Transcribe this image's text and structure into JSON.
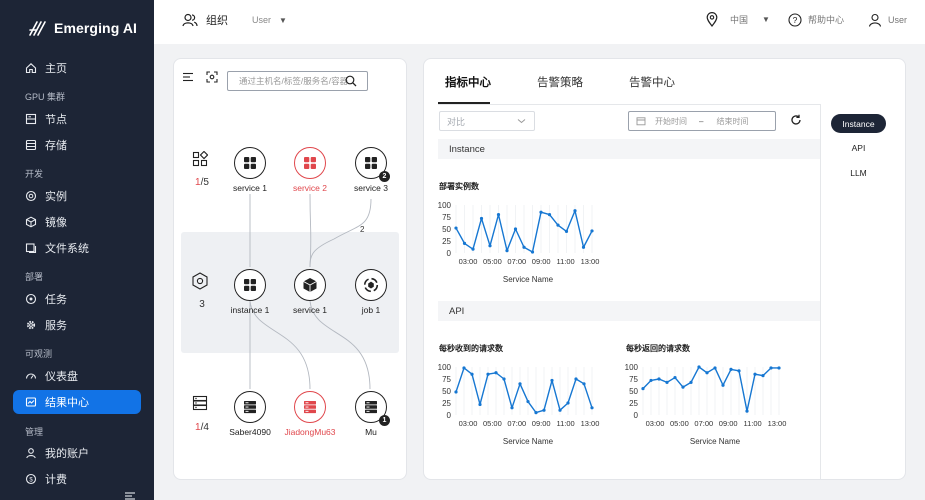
{
  "app": {
    "brand": "Emerging AI"
  },
  "topbar": {
    "org_label": "组织",
    "user_select": "User",
    "region": "中国",
    "help": "帮助中心",
    "user": "User"
  },
  "sidebar": {
    "home": "主页",
    "group_gpu": "GPU 集群",
    "nodes": "节点",
    "storage": "存储",
    "group_dev": "开发",
    "instances": "实例",
    "images": "镜像",
    "filesystem": "文件系统",
    "group_deploy": "部署",
    "tasks": "任务",
    "services": "服务",
    "group_observe": "可观测",
    "dashboard": "仪表盘",
    "results": "结果中心",
    "group_manage": "管理",
    "account": "我的账户",
    "billing": "计费",
    "active_item": "结果中心"
  },
  "topology": {
    "search_placeholder": "通过主机名/标签/服务名/容器",
    "services_row": {
      "count_highlight": "1",
      "count_rest": "/5",
      "nodes": [
        {
          "label": "service 1",
          "icon": "grid-icon",
          "status": "normal",
          "badge": ""
        },
        {
          "label": "service 2",
          "icon": "grid-icon",
          "status": "error",
          "badge": ""
        },
        {
          "label": "service 3",
          "icon": "grid-icon",
          "status": "normal",
          "badge": "2"
        }
      ]
    },
    "instances_row": {
      "count": "3",
      "nodes": [
        {
          "label": "instance 1",
          "icon": "grid-icon",
          "status": "normal",
          "badge": ""
        },
        {
          "label": "service 1",
          "icon": "cube-icon",
          "status": "normal",
          "badge": ""
        },
        {
          "label": "job 1",
          "icon": "job-icon",
          "status": "normal",
          "badge": ""
        }
      ]
    },
    "hosts_row": {
      "count_highlight": "1",
      "count_rest": "/4",
      "nodes": [
        {
          "label": "Saber4090",
          "icon": "server-icon",
          "status": "normal",
          "badge": ""
        },
        {
          "label": "JiadongMu63",
          "icon": "server-icon",
          "status": "error",
          "badge": ""
        },
        {
          "label": "Mu",
          "icon": "server-icon",
          "status": "normal",
          "badge": "1"
        }
      ]
    },
    "edge_label": "2"
  },
  "metrics": {
    "tabs": [
      "指标中心",
      "告警策略",
      "告警中心"
    ],
    "active_tab": "指标中心",
    "compare_placeholder": "对比",
    "start_placeholder": "开始时间",
    "range_sep": "–",
    "end_placeholder": "结束时间",
    "side_items": [
      "Instance",
      "API",
      "LLM"
    ],
    "active_side": "Instance",
    "section_instance": "Instance",
    "section_api": "API"
  },
  "colors": {
    "accent": "#1273e6",
    "sidebar_bg": "#1d2536",
    "error": "#e0474c",
    "line": "#1677d2"
  },
  "chart_data": [
    {
      "type": "line",
      "title": "部署实例数",
      "xlabel": "Service Name",
      "ylabel": "",
      "ylim": [
        0,
        100
      ],
      "yticks": [
        0,
        25,
        50,
        75,
        100
      ],
      "xticks": [
        "03:00",
        "05:00",
        "07:00",
        "09:00",
        "11:00",
        "13:00"
      ],
      "values": [
        52,
        20,
        8,
        72,
        15,
        80,
        5,
        50,
        12,
        2,
        85,
        80,
        58,
        45,
        88,
        12,
        46
      ]
    },
    {
      "type": "line",
      "title": "每秒收到的请求数",
      "xlabel": "Service Name",
      "ylabel": "",
      "ylim": [
        0,
        100
      ],
      "yticks": [
        0,
        25,
        50,
        75,
        100
      ],
      "xticks": [
        "03:00",
        "05:00",
        "07:00",
        "09:00",
        "11:00",
        "13:00"
      ],
      "values": [
        48,
        98,
        85,
        22,
        85,
        88,
        75,
        15,
        65,
        28,
        5,
        10,
        72,
        10,
        25,
        75,
        65,
        15
      ]
    },
    {
      "type": "line",
      "title": "每秒返回的请求数",
      "xlabel": "Service Name",
      "ylabel": "",
      "ylim": [
        0,
        100
      ],
      "yticks": [
        0,
        25,
        50,
        75,
        100
      ],
      "xticks": [
        "03:00",
        "05:00",
        "07:00",
        "09:00",
        "11:00",
        "13:00"
      ],
      "values": [
        55,
        72,
        75,
        68,
        78,
        58,
        68,
        100,
        88,
        98,
        62,
        95,
        92,
        8,
        85,
        82,
        98,
        98
      ]
    }
  ]
}
